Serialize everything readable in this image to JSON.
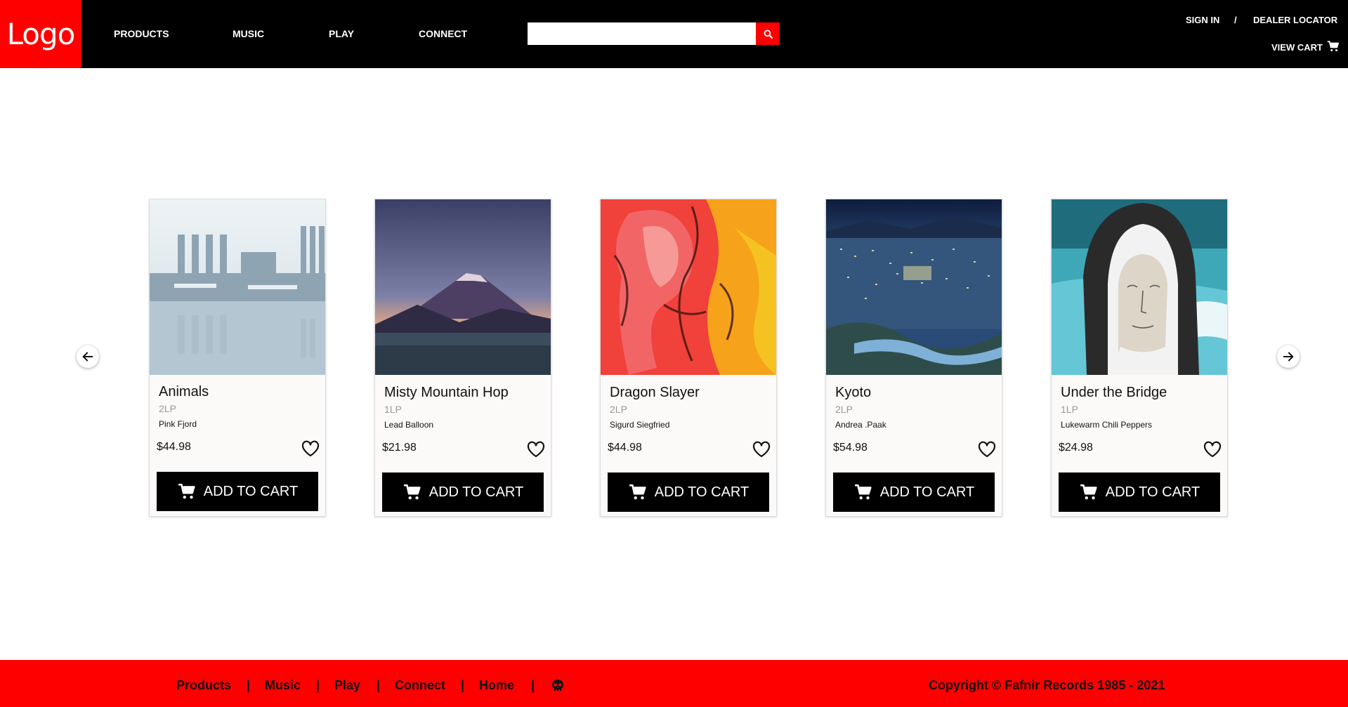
{
  "header": {
    "logo": "Logo",
    "nav": [
      "PRODUCTS",
      "MUSIC",
      "PLAY",
      "CONNECT"
    ],
    "search_placeholder": "",
    "sign_in": "SIGN IN",
    "separator": "/",
    "dealer_locator": "DEALER LOCATOR",
    "view_cart": "VIEW CART"
  },
  "products": [
    {
      "title": "Animals",
      "format": "2LP",
      "artist": "Pink Fjord",
      "price": "$44.98",
      "button": "ADD TO CART",
      "art": "factory-reflection"
    },
    {
      "title": "Misty Mountain Hop",
      "format": "1LP",
      "artist": "Lead Balloon",
      "price": "$21.98",
      "button": "ADD TO CART",
      "art": "mountain-dusk"
    },
    {
      "title": "Dragon Slayer",
      "format": "2LP",
      "artist": "Sigurd Siegfried",
      "price": "$44.98",
      "button": "ADD TO CART",
      "art": "fire-painting"
    },
    {
      "title": "Kyoto",
      "format": "2LP",
      "artist": "Andrea .Paak",
      "price": "$54.98",
      "button": "ADD TO CART",
      "art": "city-night"
    },
    {
      "title": "Under the Bridge",
      "format": "1LP",
      "artist": "Lukewarm Chili Peppers",
      "price": "$24.98",
      "button": "ADD TO CART",
      "art": "hooded-figure"
    }
  ],
  "footer": {
    "links": [
      "Products",
      "Music",
      "Play",
      "Connect",
      "Home"
    ],
    "separator": "|",
    "copyright": "Copyright © Fafnir Records 1985 - 2021"
  },
  "colors": {
    "accent": "#ff0000",
    "header_bg": "#000000",
    "card_bg": "#fcf9f9"
  },
  "icons": [
    "search-icon",
    "cart-icon",
    "heart-icon",
    "arrow-left-icon",
    "arrow-right-icon",
    "skull-icon"
  ]
}
